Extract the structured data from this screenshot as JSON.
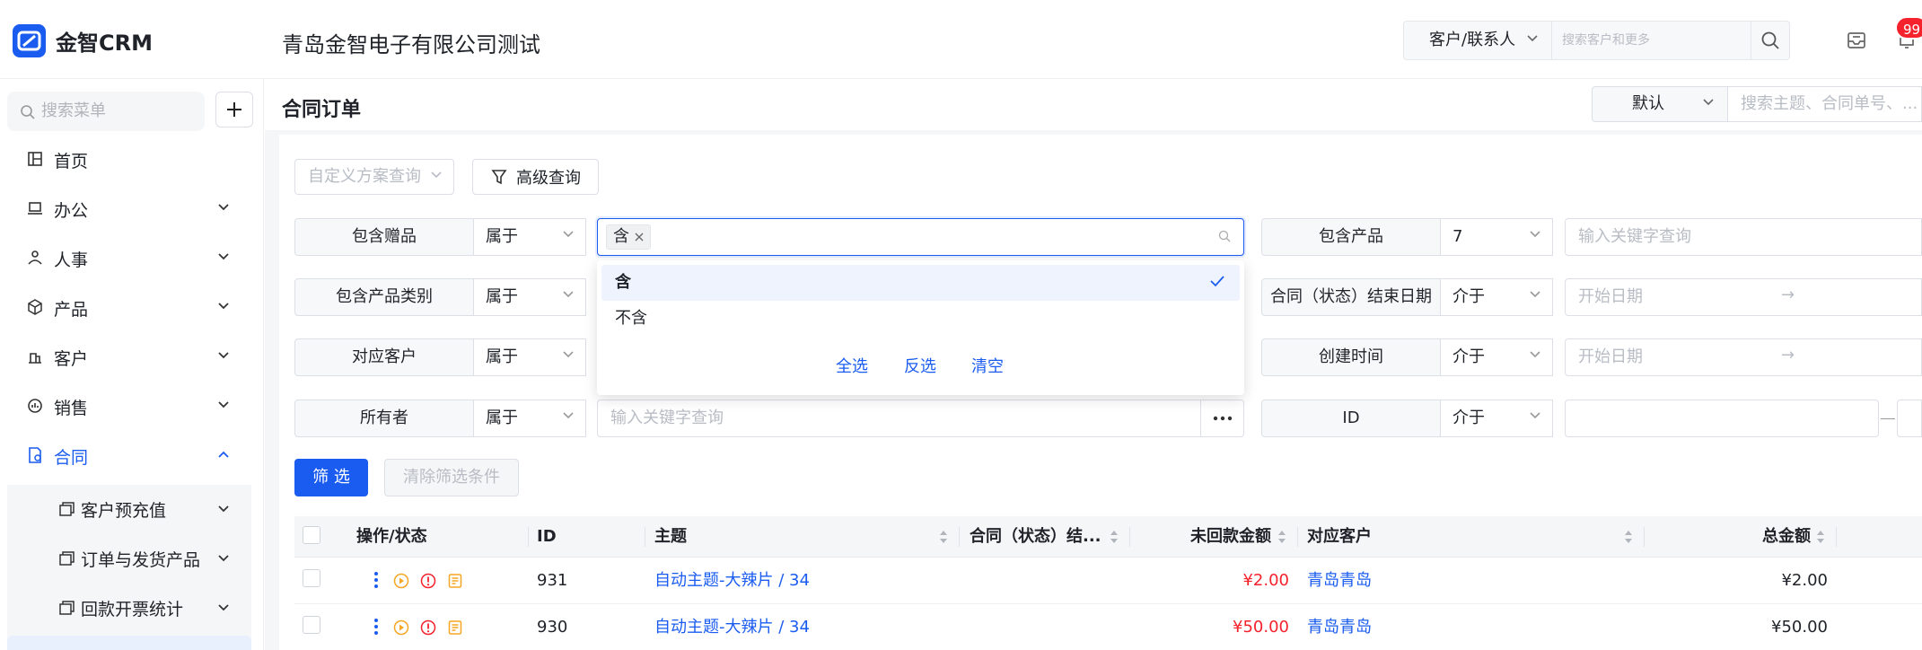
{
  "brand": {
    "name": "金智CRM"
  },
  "header": {
    "company": "青岛金智电子有限公司测试",
    "search_scope": "客户/联系人",
    "search_placeholder": "搜索客户和更多",
    "notification_count": "99"
  },
  "sidebar": {
    "search_placeholder": "搜索菜单",
    "items": [
      {
        "label": "首页",
        "icon": "home-icon"
      },
      {
        "label": "办公",
        "icon": "office-icon"
      },
      {
        "label": "人事",
        "icon": "hr-icon"
      },
      {
        "label": "产品",
        "icon": "product-icon"
      },
      {
        "label": "客户",
        "icon": "customer-icon"
      },
      {
        "label": "销售",
        "icon": "sales-icon"
      },
      {
        "label": "合同",
        "icon": "contract-icon",
        "expanded": true
      }
    ],
    "sub_items": [
      {
        "label": "客户预充值",
        "icon": "folder-icon"
      },
      {
        "label": "订单与发货产品",
        "icon": "folder-icon"
      },
      {
        "label": "回款开票统计",
        "icon": "folder-icon"
      }
    ]
  },
  "page": {
    "title": "合同订单",
    "view_select": "默认",
    "search_placeholder": "搜索主题、合同单号、..."
  },
  "filters": {
    "custom_plan_placeholder": "自定义方案查询",
    "advanced_query": "高级查询",
    "rows_left": [
      {
        "label": "包含赠品",
        "op": "属于"
      },
      {
        "label": "包含产品类别",
        "op": "属于"
      },
      {
        "label": "对应客户",
        "op": "属于"
      },
      {
        "label": "所有者",
        "op": "属于",
        "placeholder": "输入关键字查询"
      }
    ],
    "rows_right": [
      {
        "label": "包含产品",
        "op": "7",
        "placeholder": "输入关键字查询"
      },
      {
        "label": "合同（状态）结束日期",
        "op": "介于",
        "placeholder": "开始日期",
        "arrow": "→"
      },
      {
        "label": "创建时间",
        "op": "介于",
        "placeholder": "开始日期",
        "arrow": "→"
      },
      {
        "label": "ID",
        "op": "介于",
        "placeholder": ""
      }
    ],
    "gift_selected_tag": "含",
    "dropdown": {
      "options": [
        {
          "label": "含",
          "selected": true
        },
        {
          "label": "不含",
          "selected": false
        }
      ],
      "select_all": "全选",
      "invert": "反选",
      "clear": "清空"
    },
    "apply_button": "筛 选",
    "clear_button": "清除筛选条件"
  },
  "table": {
    "columns": [
      "操作/状态",
      "ID",
      "主题",
      "合同（状态）结...",
      "未回款金额",
      "对应客户",
      "总金额"
    ],
    "rows": [
      {
        "id": "931",
        "subject": "自动主题-大辣片 / 34",
        "unpaid": "¥2.00",
        "customer": "青岛青岛",
        "total": "¥2.00"
      },
      {
        "id": "930",
        "subject": "自动主题-大辣片 / 34",
        "unpaid": "¥50.00",
        "customer": "青岛青岛",
        "total": "¥50.00"
      }
    ]
  },
  "colors": {
    "accent": "#1b5cf0",
    "danger": "#f5222d",
    "warning": "#f5a623"
  }
}
